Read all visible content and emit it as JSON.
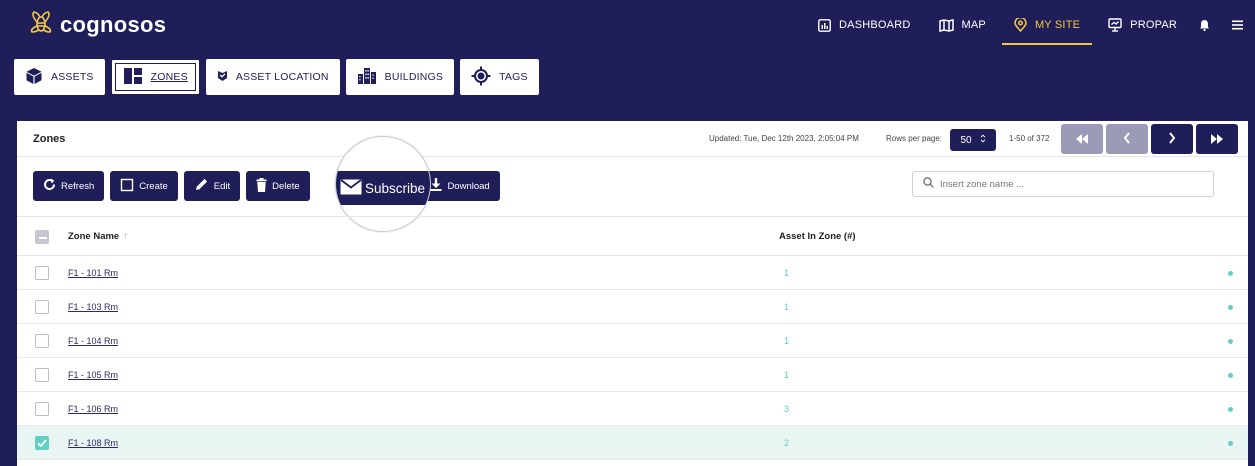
{
  "app": {
    "name": "cognosos"
  },
  "nav": {
    "items": [
      {
        "label": "DASHBOARD",
        "icon": "dashboard-icon",
        "active": false
      },
      {
        "label": "MAP",
        "icon": "map-icon",
        "active": false
      },
      {
        "label": "MY SITE",
        "icon": "location-pin-icon",
        "active": true
      },
      {
        "label": "PROPAR",
        "icon": "presentation-icon",
        "active": false
      }
    ],
    "accent_color": "#f2c744"
  },
  "tabs": [
    {
      "label": "ASSETS",
      "icon": "cube-icon"
    },
    {
      "label": "ZONES",
      "icon": "zones-grid-icon",
      "active": true
    },
    {
      "label": "ASSET LOCATION",
      "icon": "asset-location-icon"
    },
    {
      "label": "BUILDINGS",
      "icon": "buildings-icon"
    },
    {
      "label": "TAGS",
      "icon": "tag-target-icon"
    }
  ],
  "panel": {
    "title": "Zones",
    "updated": "Updated: Tue, Dec 12th 2023, 2:05:04 PM",
    "rows_per_page_label": "Rows per page:",
    "rows_per_page_value": "50",
    "range": "1-50 of 372"
  },
  "toolbar": {
    "refresh": "Refresh",
    "create": "Create",
    "edit": "Edit",
    "delete": "Delete",
    "subscribe": "Subscribe",
    "download": "Download"
  },
  "search": {
    "placeholder": "Insert zone name ..."
  },
  "table": {
    "columns": [
      "Zone Name",
      "Asset In Zone (#)"
    ],
    "rows": [
      {
        "zone": "F1 - 101 Rm",
        "count": "1",
        "selected": false
      },
      {
        "zone": "F1 - 103 Rm",
        "count": "1",
        "selected": false
      },
      {
        "zone": "F1 - 104 Rm",
        "count": "1",
        "selected": false
      },
      {
        "zone": "F1 - 105 Rm",
        "count": "1",
        "selected": false
      },
      {
        "zone": "F1 - 106 Rm",
        "count": "3",
        "selected": false
      },
      {
        "zone": "F1 - 108 Rm",
        "count": "2",
        "selected": true
      }
    ]
  },
  "colors": {
    "brand": "#1f1e59",
    "teal": "#5fd0c3"
  }
}
